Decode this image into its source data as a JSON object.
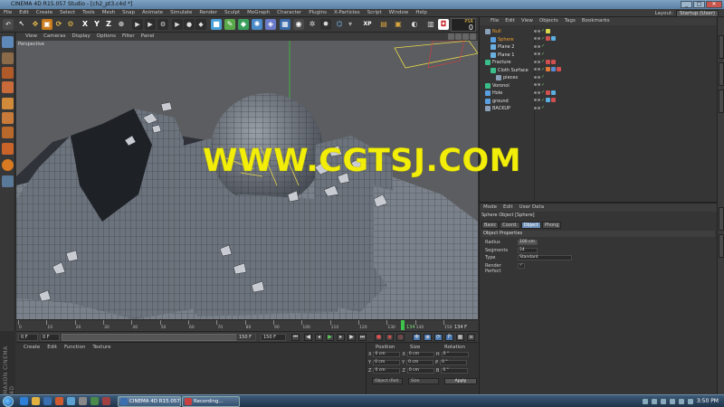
{
  "window": {
    "title": "CINEMA 4D R15.057 Studio - [ch2_pt3.c4d *]",
    "controls": [
      "_",
      "□",
      "✕"
    ]
  },
  "menubar": {
    "items": [
      "File",
      "Edit",
      "Create",
      "Select",
      "Tools",
      "Mesh",
      "Snap",
      "Animate",
      "Simulate",
      "Render",
      "Sculpt",
      "MoGraph",
      "Character",
      "Plugins",
      "X-Particles",
      "Script",
      "Window",
      "Help"
    ],
    "layout_label": "Layout:",
    "layout_value": "Startup (User)"
  },
  "toolbar": {
    "psr_label": "PSR",
    "psr_value": "0"
  },
  "viewport": {
    "menu": [
      "View",
      "Cameras",
      "Display",
      "Options",
      "Filter",
      "Panel"
    ],
    "label": "Perspective"
  },
  "watermark": "WWW.CGTSJ.COM",
  "timeline": {
    "ticks": [
      "0",
      "10",
      "20",
      "30",
      "40",
      "50",
      "60",
      "70",
      "80",
      "90",
      "100",
      "110",
      "120",
      "130",
      "140",
      "150"
    ],
    "current_frame": "134",
    "end_label": "134 F"
  },
  "transport": {
    "start_field": "0 F",
    "min_field": "0 F",
    "max_field": "150 F",
    "end_field": "150 F"
  },
  "material_panel": {
    "menu": [
      "Create",
      "Edit",
      "Function",
      "Texture"
    ],
    "brand": "MAXON CINEMA 4D"
  },
  "coordinates": {
    "headers": [
      "Position",
      "Size",
      "Rotation"
    ],
    "rows": [
      {
        "axis": "X",
        "pos": "0 cm",
        "size_axis": "X",
        "size": "0 cm",
        "rot_axis": "H",
        "rot": "0 °"
      },
      {
        "axis": "Y",
        "pos": "0 cm",
        "size_axis": "Y",
        "size": "0 cm",
        "rot_axis": "P",
        "rot": "0 °"
      },
      {
        "axis": "Z",
        "pos": "0 cm",
        "size_axis": "Z",
        "size": "0 cm",
        "rot_axis": "B",
        "rot": "0 °"
      }
    ],
    "mode_select": "Object (Rel)",
    "size_select": "Size",
    "apply_label": "Apply"
  },
  "object_manager": {
    "menu": [
      "File",
      "Edit",
      "View",
      "Objects",
      "Tags",
      "Bookmarks"
    ],
    "objects": [
      {
        "name": "Null",
        "highlight": true
      },
      {
        "name": "Sphere",
        "highlight": true
      },
      {
        "name": "Plane 2",
        "highlight": false
      },
      {
        "name": "Plane 1",
        "highlight": false
      },
      {
        "name": "Fracture",
        "highlight": false
      },
      {
        "name": "Cloth Surface",
        "highlight": false
      },
      {
        "name": "pieces",
        "highlight": false
      },
      {
        "name": "Voronoi",
        "highlight": false
      },
      {
        "name": "Hole",
        "highlight": false
      },
      {
        "name": "ground",
        "highlight": false
      },
      {
        "name": "BACKUP",
        "highlight": false
      }
    ]
  },
  "attribute_manager": {
    "menu": [
      "Mode",
      "Edit",
      "User Data"
    ],
    "header": "Sphere Object [Sphere]",
    "tabs": [
      "Basic",
      "Coord.",
      "Object",
      "Phong"
    ],
    "active_tab": "Object",
    "section": "Object Properties",
    "rows": [
      {
        "label": "Radius",
        "value": "100 cm"
      },
      {
        "label": "Segments",
        "value": "24"
      },
      {
        "label": "Type",
        "value": "Standard"
      },
      {
        "label": "Render Perfect",
        "value": "✓"
      }
    ]
  },
  "taskbar": {
    "tasks": [
      "CINEMA 4D R15.057 ...",
      "Recording..."
    ],
    "clock": "3:50 PM"
  },
  "colors": {
    "accent": "#6c8fb8",
    "watermark": "#f2ee0a",
    "timeline_cursor": "#3ec44a"
  }
}
